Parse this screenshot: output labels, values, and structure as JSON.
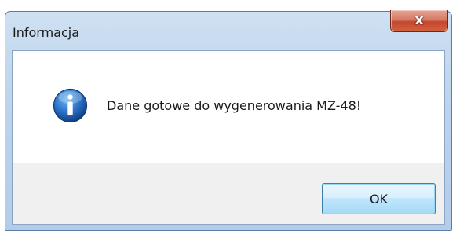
{
  "window": {
    "title": "Informacja",
    "close_glyph": "x"
  },
  "dialog": {
    "icon": "information-icon",
    "message": "Dane gotowe do wygenerowania MZ-48!",
    "ok_label": "OK"
  },
  "colors": {
    "frame": "#bcd4ec",
    "close_button": "#c3472e",
    "button_bar": "#f0f0f0",
    "ok_button_border": "#3c7fb1",
    "info_icon": "#1f5fb4"
  }
}
